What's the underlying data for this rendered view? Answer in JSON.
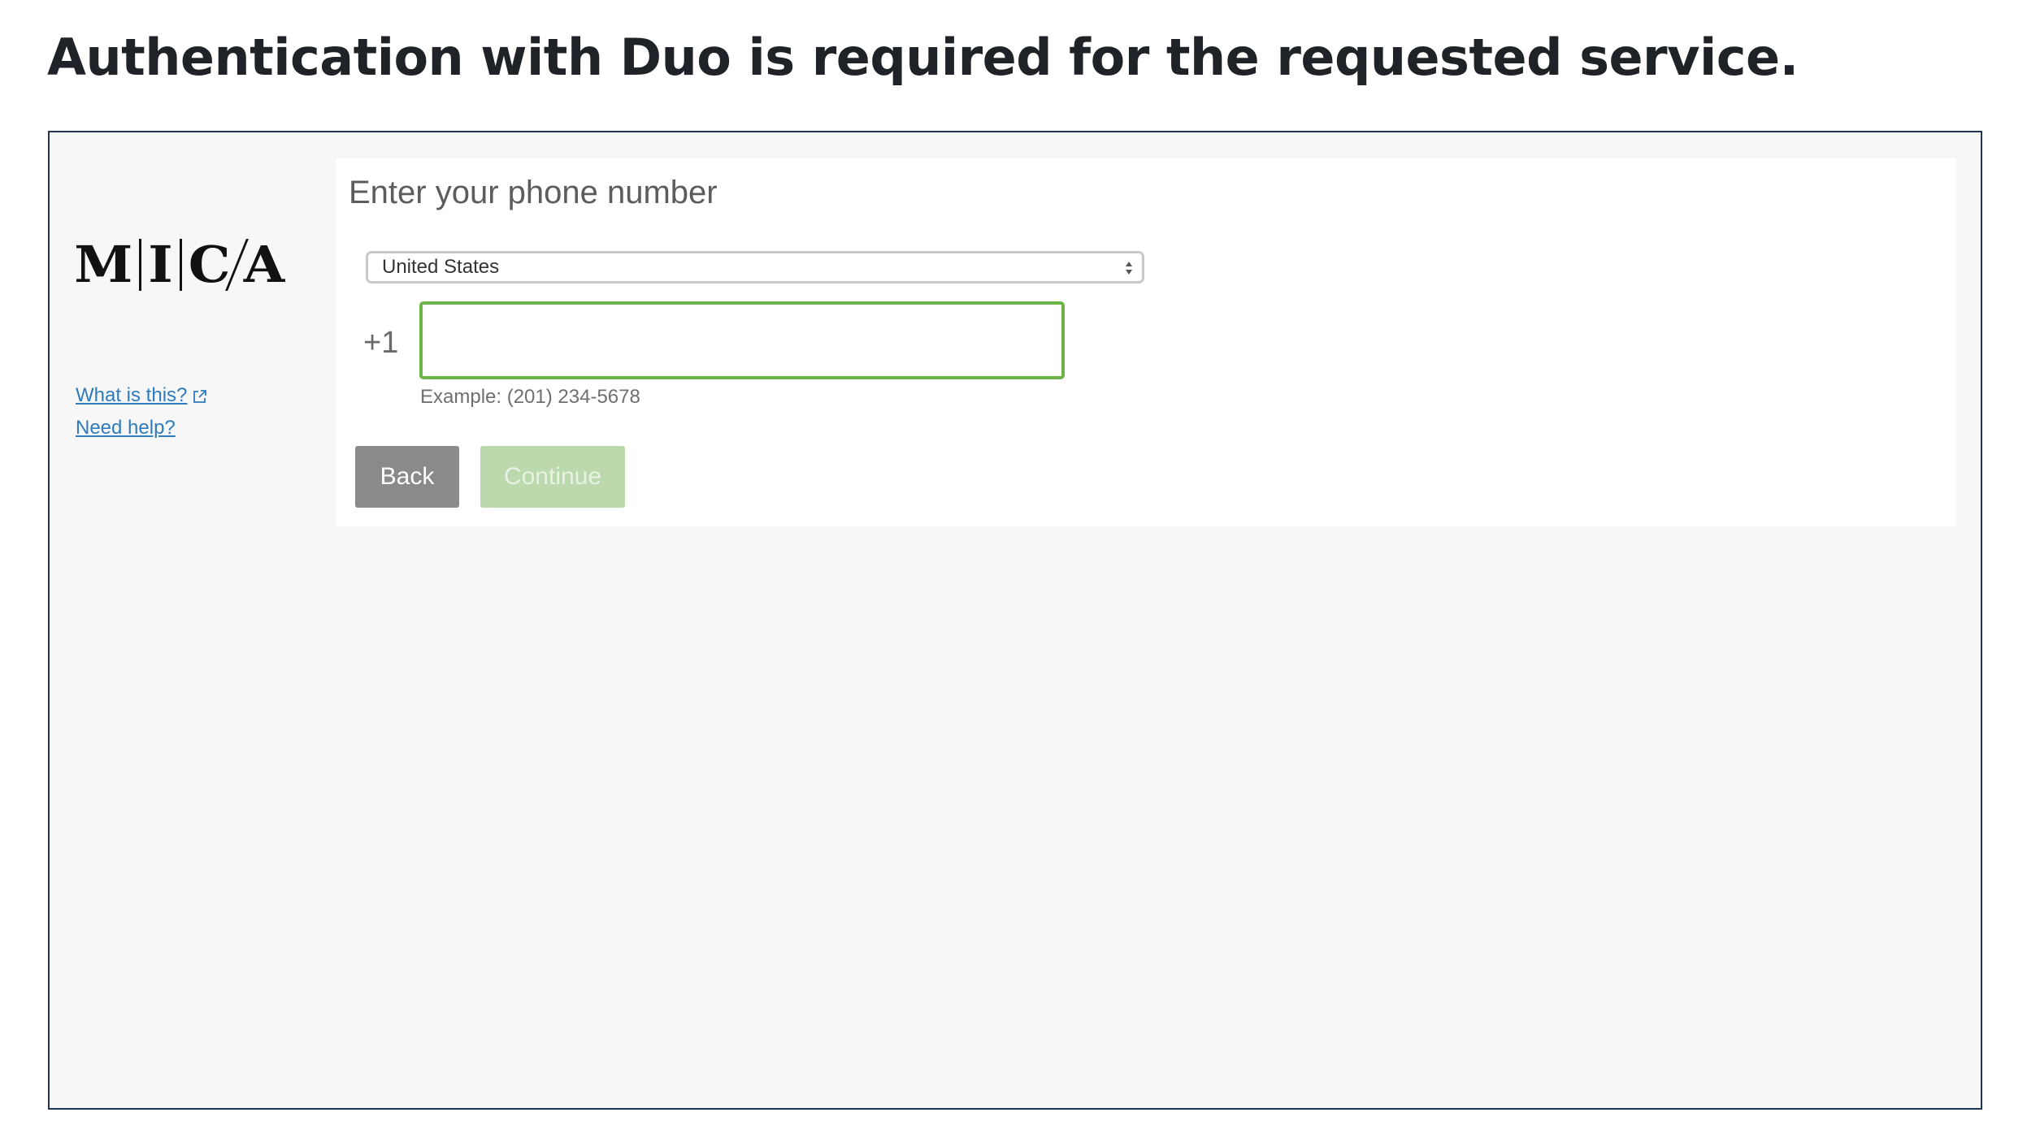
{
  "page": {
    "title": "Authentication with Duo is required for the requested service."
  },
  "sidebar": {
    "logo_letters": [
      "M",
      "I",
      "C",
      "A"
    ],
    "links": {
      "what_is_this": "What is this?",
      "need_help": "Need help?"
    }
  },
  "form": {
    "heading": "Enter your phone number",
    "country_selected": "United States",
    "dial_code": "+1",
    "phone_value": "",
    "example": "Example: (201) 234-5678",
    "back_label": "Back",
    "continue_label": "Continue"
  },
  "colors": {
    "frame_border": "#1e3654",
    "link": "#2e7bbd",
    "input_focus_border": "#6cb348",
    "back_button": "#8a8a8a",
    "continue_button_disabled": "#bcd9ad"
  },
  "icons": {
    "external_link": "external-link-icon",
    "select_arrows": "select-arrows-icon"
  }
}
